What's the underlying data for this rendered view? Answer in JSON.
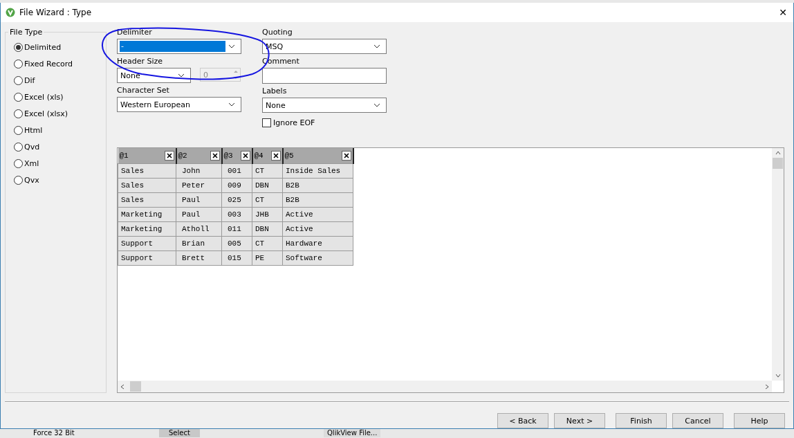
{
  "window": {
    "title": "File Wizard : Type",
    "close": "✕"
  },
  "file_type": {
    "title": "File Type",
    "options": [
      {
        "label": "Delimited",
        "selected": true
      },
      {
        "label": "Fixed Record",
        "selected": false
      },
      {
        "label": "Dif",
        "selected": false
      },
      {
        "label": "Excel (xls)",
        "selected": false
      },
      {
        "label": "Excel (xlsx)",
        "selected": false
      },
      {
        "label": "Html",
        "selected": false
      },
      {
        "label": "Qvd",
        "selected": false
      },
      {
        "label": "Xml",
        "selected": false
      },
      {
        "label": "Qvx",
        "selected": false
      }
    ]
  },
  "delimiter": {
    "label": "Delimiter",
    "value": "-"
  },
  "quoting": {
    "label": "Quoting",
    "value": "MSQ"
  },
  "header_size": {
    "label": "Header Size",
    "value": "None",
    "spin_value": "0"
  },
  "comment": {
    "label": "Comment"
  },
  "character_set": {
    "label": "Character Set",
    "value": "Western European"
  },
  "labels": {
    "label": "Labels",
    "value": "None"
  },
  "ignore_eof": {
    "label": "Ignore EOF",
    "checked": false
  },
  "table": {
    "columns": [
      "@1",
      "@2",
      "@3",
      "@4",
      "@5"
    ],
    "rows": [
      [
        "Sales",
        "John",
        "001",
        "CT",
        "Inside Sales"
      ],
      [
        "Sales",
        "Peter",
        "009",
        "DBN",
        "B2B"
      ],
      [
        "Sales",
        "Paul",
        "025",
        "CT",
        "B2B"
      ],
      [
        "Marketing",
        "Paul",
        "003",
        "JHB",
        "Active"
      ],
      [
        "Marketing",
        "Atholl",
        "011",
        "DBN",
        "Active"
      ],
      [
        "Support",
        "Brian",
        "005",
        "CT",
        "Hardware"
      ],
      [
        "Support",
        "Brett",
        "015",
        "PE",
        "Software"
      ]
    ]
  },
  "buttons": [
    "< Back",
    "Next >",
    "Finish",
    "Cancel",
    "Help"
  ],
  "background_window": {
    "items": [
      "Force 32 Bit",
      "Select",
      "QlikView File..."
    ]
  }
}
